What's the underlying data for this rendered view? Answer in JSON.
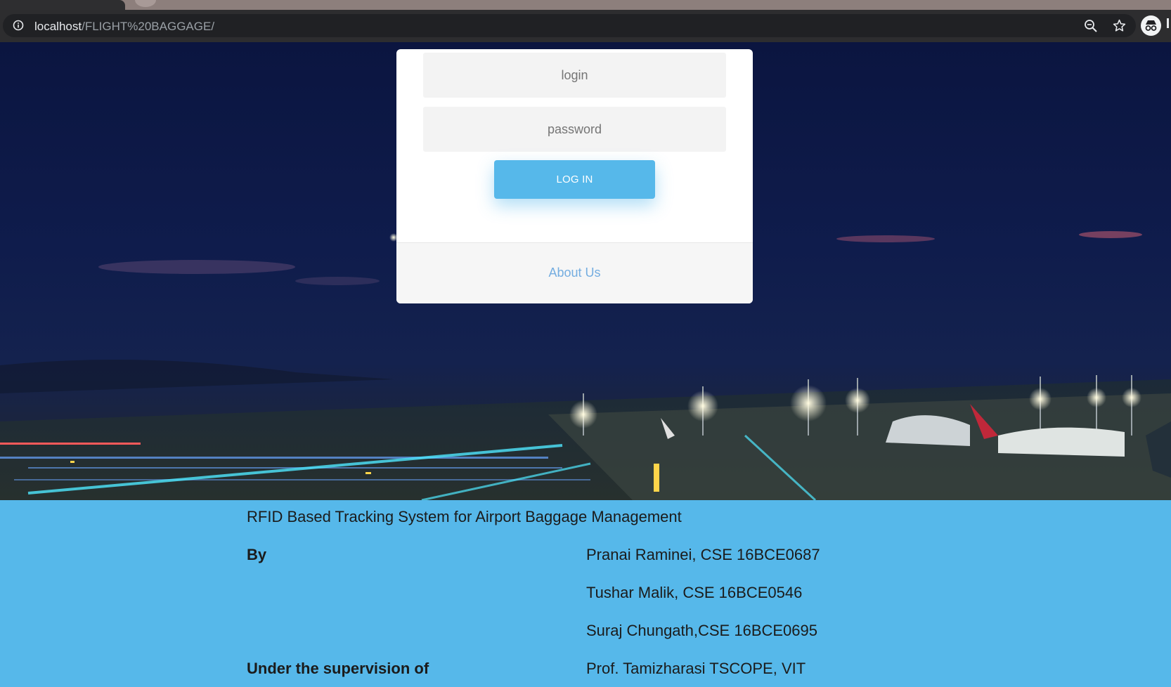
{
  "browser": {
    "url_host": "localhost",
    "url_path": "/FLIGHT%20BAGGAGE/",
    "icons": [
      "info-icon",
      "zoom-icon",
      "star-icon",
      "incognito-icon"
    ]
  },
  "login_form": {
    "login_placeholder": "login",
    "password_placeholder": "password",
    "submit_label": "LOG IN",
    "footer_link": "About Us"
  },
  "info": {
    "title": "RFID Based Tracking System for Airport Baggage Management",
    "by_label": "By",
    "authors": [
      "Pranai Raminei, CSE 16BCE0687",
      "Tushar Malik, CSE 16BCE0546",
      "Suraj Chungath,CSE 16BCE0695"
    ],
    "supervision_label": "Under the supervision of",
    "supervisor": "Prof. Tamizharasi TSCOPE, VIT"
  },
  "colors": {
    "accent": "#56b8ea",
    "link": "#74ade0",
    "night_sky": "#0f1c4c"
  }
}
